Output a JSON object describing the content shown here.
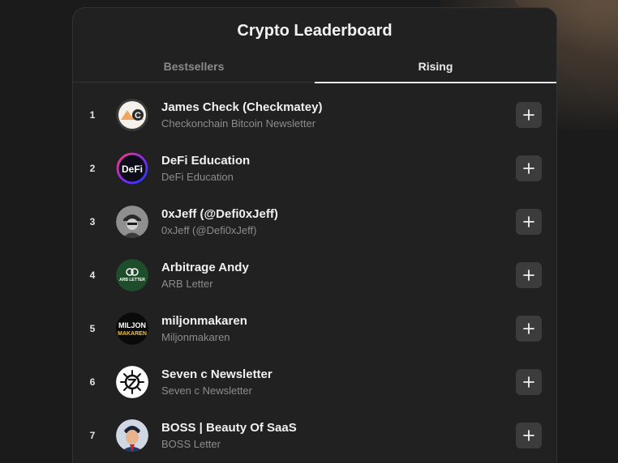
{
  "title": "Crypto Leaderboard",
  "tabs": [
    {
      "label": "Bestsellers",
      "active": false
    },
    {
      "label": "Rising",
      "active": true
    }
  ],
  "entries": [
    {
      "rank": "1",
      "name": "James Check (Checkmatey)",
      "subtitle": "Checkonchain Bitcoin Newsletter",
      "avatar_text": "C"
    },
    {
      "rank": "2",
      "name": "DeFi Education",
      "subtitle": "DeFi Education",
      "avatar_text": "DeFi"
    },
    {
      "rank": "3",
      "name": "0xJeff (@Defi0xJeff)",
      "subtitle": "0xJeff (@Defi0xJeff)",
      "avatar_text": ""
    },
    {
      "rank": "4",
      "name": "Arbitrage Andy",
      "subtitle": "ARB Letter",
      "avatar_text": "ARB LETTER"
    },
    {
      "rank": "5",
      "name": "miljonmakaren",
      "subtitle": "Miljonmakaren",
      "avatar_text": [
        "MILJON",
        "MAKAREN"
      ]
    },
    {
      "rank": "6",
      "name": "Seven c Newsletter",
      "subtitle": "Seven c Newsletter",
      "avatar_text": ""
    },
    {
      "rank": "7",
      "name": "BOSS | Beauty Of SaaS",
      "subtitle": "BOSS Letter",
      "avatar_text": ""
    }
  ],
  "icons": {
    "add": "plus-icon"
  },
  "colors": {
    "background": "#1b1b1b",
    "panel": "#212121",
    "button": "#3c3c3c",
    "text_primary": "#f0f0f0",
    "text_secondary": "#8c8c8c"
  }
}
